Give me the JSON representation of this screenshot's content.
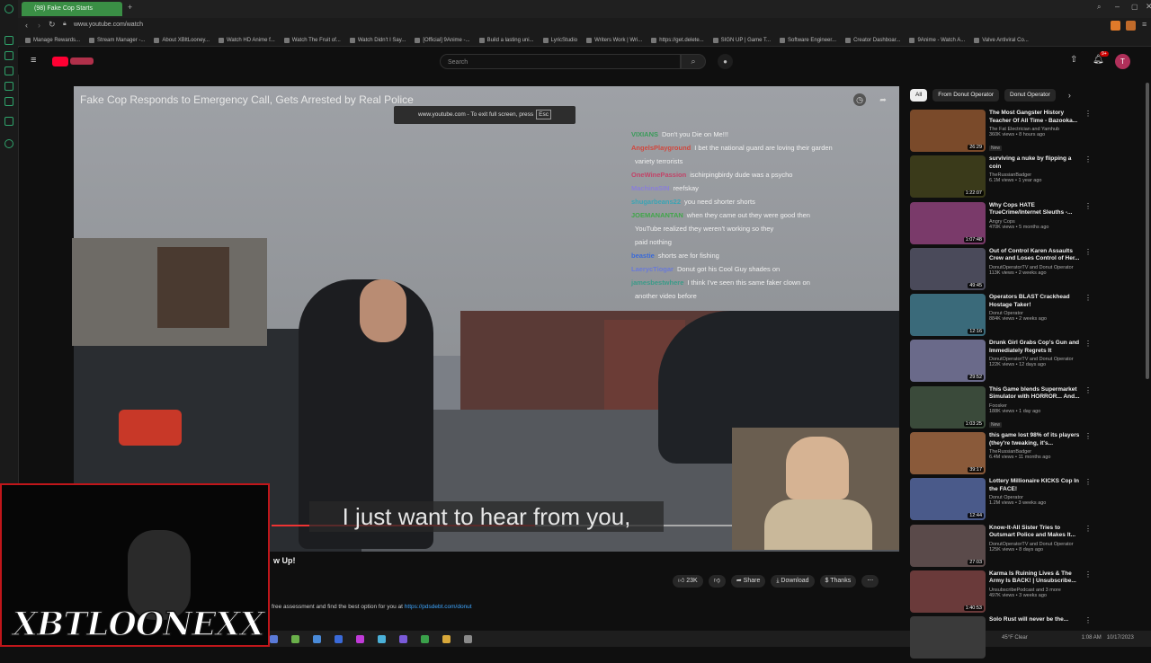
{
  "browser": {
    "tab_title": "(98) Fake Cop Starts",
    "url": "www.youtube.com/watch",
    "bookmarks": [
      "Manage Rewards...",
      "Stream Manager -...",
      "About XBltLooney...",
      "Watch HD Anime f...",
      "Watch The Fruit of...",
      "Watch Didn't I Say...",
      "[Official] 9Anime -...",
      "Build a lasting uni...",
      "LyricStudio",
      "Writers Work | Wri...",
      "https://get.delete...",
      "SIGN UP | Game T...",
      "Software Engineer...",
      "Creator Dashboar...",
      "9Anime - Watch A...",
      "Valve Antiviral Co..."
    ]
  },
  "youtube": {
    "search_placeholder": "Search",
    "avatar_letter": "T",
    "notification_count": "9+"
  },
  "player": {
    "title": "Fake Cop Responds to Emergency Call, Gets Arrested by Real Police",
    "fullscreen_toast": "www.youtube.com - To exit full screen, press",
    "fullscreen_key": "Esc",
    "caption": "I just want to hear from you,",
    "progress": 0.42
  },
  "chat": [
    {
      "user": "VIXIANS",
      "text": "Don't you Die on Me!!!",
      "color": "#3a9b5a"
    },
    {
      "user": "AngelsPlayground",
      "text": "I bet the national guard are loving their garden",
      "color": "#d2463c"
    },
    {
      "user": "",
      "text": "variety terrorists",
      "color": "#d2463c"
    },
    {
      "user": "OneWinePassion",
      "text": "ischirpingbirdy dude was a psycho",
      "color": "#c24468"
    },
    {
      "user": "MachinaSIN",
      "text": "reefskay",
      "color": "#8a7fd8"
    },
    {
      "user": "shugarbeans22",
      "text": "you need shorter shorts",
      "color": "#3aa4b4"
    },
    {
      "user": "JOEMANANTAN",
      "text": "when they came out they were good then",
      "color": "#41a64a"
    },
    {
      "user": "",
      "text": "YouTube realized they weren't working so they",
      "color": "#41a64a"
    },
    {
      "user": "",
      "text": "paid nothing",
      "color": "#41a64a"
    },
    {
      "user": "beastie",
      "text": "shorts are for fishing",
      "color": "#3a6ad8"
    },
    {
      "user": "LaerycTiogar",
      "text": "Donut got his Cool Guy shades on",
      "color": "#6a7ad8"
    },
    {
      "user": "jamesbestwhere",
      "text": "I think I've seen this same faker clown on",
      "color": "#3a9b88"
    },
    {
      "user": "",
      "text": "another video before",
      "color": "#3a9b88"
    }
  ],
  "below": {
    "partial_title": "w Up!",
    "like_count": "23K",
    "share": "Share",
    "download": "Download",
    "thanks": "Thanks",
    "desc_text": "free assessment and find the best option for you at",
    "desc_link": "https://pdsdebt.com/donut"
  },
  "overlay": {
    "logo_text": "XBTLOONEXX"
  },
  "taskbar": {
    "weather": "45°F Clear",
    "time": "1:08 AM",
    "date": "10/17/2023"
  },
  "sidebar": {
    "chips": [
      "All",
      "From Donut Operator",
      "Donut Operator"
    ],
    "videos": [
      {
        "title": "The Most Gangster History Teacher Of All Time - Bazooka...",
        "channel": "The Fat Electrician and Yamhub",
        "stats": "360K views • 8 hours ago",
        "badge": "New",
        "duration": "26:29",
        "color": "#7a4a2a"
      },
      {
        "title": "surviving a nuke by flipping a coin",
        "channel": "TheRussianBadger",
        "stats": "6.1M views • 1 year ago",
        "badge": "",
        "duration": "1:22:07",
        "color": "#3a3a1a"
      },
      {
        "title": "Why Cops HATE TrueCrime/Internet Sleuths -...",
        "channel": "Angry Cops",
        "stats": "470K views • 5 months ago",
        "badge": "",
        "duration": "1:07:48",
        "color": "#7a3a6a"
      },
      {
        "title": "Out of Control Karen Assaults Crew and Loses Control of Her...",
        "channel": "DonutOperatorTV and Donut Operator",
        "stats": "113K views • 2 weeks ago",
        "badge": "",
        "duration": "49:45",
        "color": "#4a4a5a"
      },
      {
        "title": "Operators BLAST Crackhead Hostage Taker!",
        "channel": "Donut Operator",
        "stats": "884K views • 2 weeks ago",
        "badge": "",
        "duration": "12:16",
        "color": "#3a6a7a"
      },
      {
        "title": "Drunk Girl Grabs Cop's Gun and Immediately Regrets It",
        "channel": "DonutOperatorTV and Donut Operator",
        "stats": "122K views • 12 days ago",
        "badge": "",
        "duration": "29:52",
        "color": "#6a6a8a"
      },
      {
        "title": "This Game blends Supermarket Simulator with HORROR... And...",
        "channel": "Foosker",
        "stats": "188K views • 1 day ago",
        "badge": "New",
        "duration": "1:03:25",
        "color": "#3a4a3a"
      },
      {
        "title": "this game lost 98% of its players (they're tweaking, it's...",
        "channel": "TheRussianBadger",
        "stats": "6.4M views • 11 months ago",
        "badge": "",
        "duration": "39:17",
        "color": "#8a5a3a"
      },
      {
        "title": "Lottery Millionaire KICKS Cop In the FACE!",
        "channel": "Donut Operator",
        "stats": "1.2M views • 3 weeks ago",
        "badge": "",
        "duration": "12:44",
        "color": "#4a5a8a"
      },
      {
        "title": "Know-It-All Sister Tries to Outsmart Police and Makes It...",
        "channel": "DonutOperatorTV and Donut Operator",
        "stats": "125K views • 8 days ago",
        "badge": "",
        "duration": "27:03",
        "color": "#5a4a4a"
      },
      {
        "title": "Karma Is Ruining Lives & The Army Is BACK! | Unsubscribe...",
        "channel": "UnsubscribePodcast and 3 more",
        "stats": "497K views • 3 weeks ago",
        "badge": "",
        "duration": "1:40:53",
        "color": "#6a3a3a"
      },
      {
        "title": "Solo Rust will never be the...",
        "channel": "",
        "stats": "",
        "badge": "",
        "duration": "",
        "color": "#3a3a3a"
      }
    ]
  },
  "colors": {
    "accent": "#3a8f45",
    "yt_red": "#ff0033",
    "frame_red": "#c0161a"
  }
}
